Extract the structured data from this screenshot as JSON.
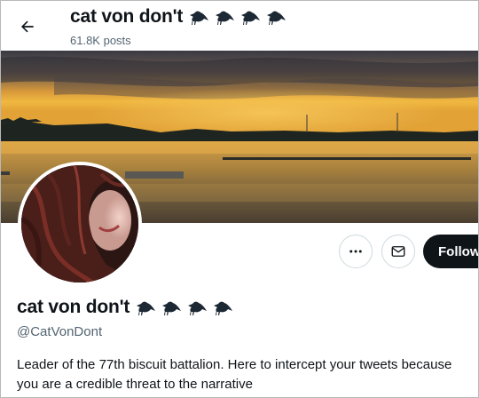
{
  "header": {
    "display_name": "cat von don't",
    "post_count": "61.8K posts",
    "back_icon": "arrow-left-icon"
  },
  "profile": {
    "display_name": "cat von don't",
    "name_emoji": [
      "crow-icon",
      "crow-icon",
      "crow-icon",
      "crow-icon"
    ],
    "handle": "@CatVonDont",
    "bio": "Leader of the 77th biscuit battalion.  Here to intercept your tweets because you are a credible threat to the narrative"
  },
  "actions": {
    "more_icon": "more-icon",
    "message_icon": "mail-icon",
    "follow_label": "Follow"
  },
  "colors": {
    "text": "#0f1419",
    "secondary_text": "#536471",
    "border": "#cfd9de",
    "follow_bg": "#0f1419"
  }
}
